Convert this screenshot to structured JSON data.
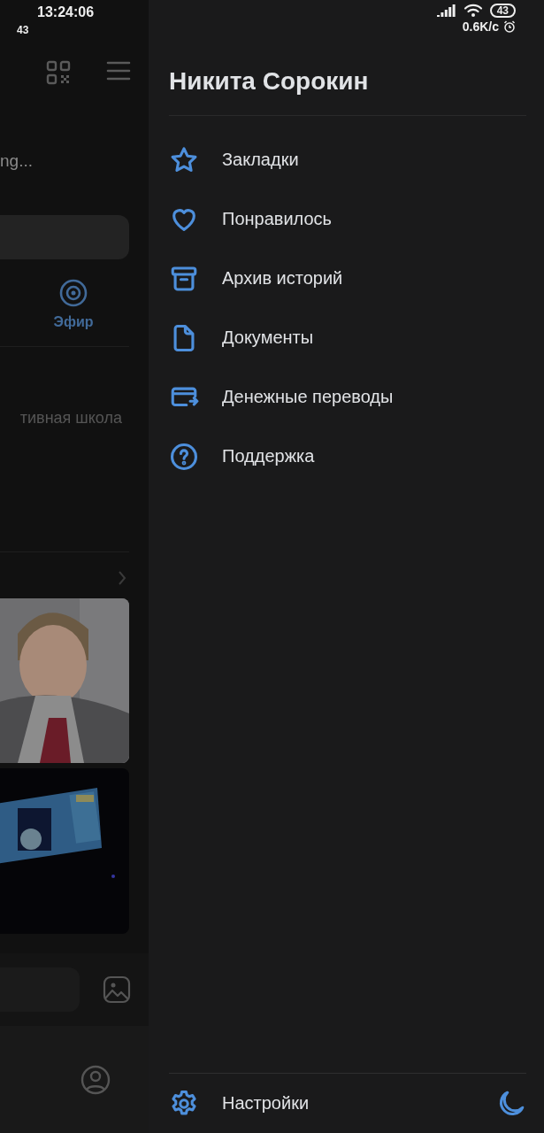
{
  "status_bar": {
    "time": "13:24:06",
    "notification_count": "43",
    "battery": "43",
    "network_speed": "0.6K/с"
  },
  "background_screen": {
    "status_text": "ng...",
    "tab_label": "Эфир",
    "post_text": "тивная школа"
  },
  "drawer": {
    "user_name": "Никита Сорокин",
    "items": [
      {
        "label": "Закладки",
        "kind": "star"
      },
      {
        "label": "Понравилось",
        "kind": "heart"
      },
      {
        "label": "Архив историй",
        "kind": "archive"
      },
      {
        "label": "Документы",
        "kind": "document"
      },
      {
        "label": "Денежные переводы",
        "kind": "card"
      },
      {
        "label": "Поддержка",
        "kind": "help"
      }
    ],
    "settings_label": "Настройки"
  }
}
